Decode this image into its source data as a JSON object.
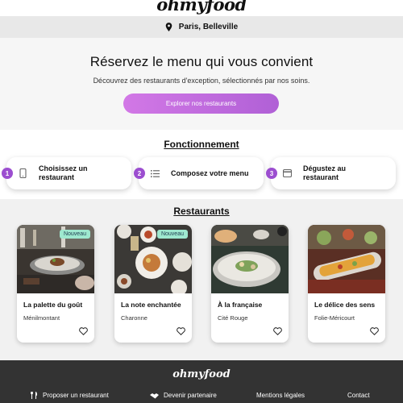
{
  "header": {
    "logo": "ohmyfood"
  },
  "location": {
    "text": "Paris, Belleville"
  },
  "hero": {
    "title": "Réservez le menu qui vous convient",
    "subtitle": "Découvrez des restaurants d'exception, sélectionnés par nos soins.",
    "cta": "Explorer nos restaurants"
  },
  "how": {
    "title": "Fonctionnement",
    "steps": [
      {
        "num": "1",
        "icon": "phone-icon",
        "label": "Choisissez un restaurant"
      },
      {
        "num": "2",
        "icon": "list-icon",
        "label": "Composez votre menu"
      },
      {
        "num": "3",
        "icon": "dish-icon",
        "label": "Dégustez au restaurant"
      }
    ]
  },
  "restaurants": {
    "title": "Restaurants",
    "items": [
      {
        "name": "La palette du goût",
        "area": "Ménilmontant",
        "badge": "Nouveau"
      },
      {
        "name": "La note enchantée",
        "area": "Charonne",
        "badge": "Nouveau"
      },
      {
        "name": "À la française",
        "area": "Cité Rouge",
        "badge": ""
      },
      {
        "name": "Le délice des sens",
        "area": "Folie-Méricourt",
        "badge": ""
      }
    ]
  },
  "footer": {
    "logo": "ohmyfood",
    "links": [
      {
        "label": "Proposer un restaurant",
        "icon": "cutlery-icon"
      },
      {
        "label": "Devenir partenaire",
        "icon": "handshake-icon"
      },
      {
        "label": "Mentions légales",
        "icon": ""
      },
      {
        "label": "Contact",
        "icon": ""
      }
    ]
  },
  "colors": {
    "accent": "#9c4ed0",
    "badge": "#9ee8cf",
    "footer": "#333333"
  }
}
